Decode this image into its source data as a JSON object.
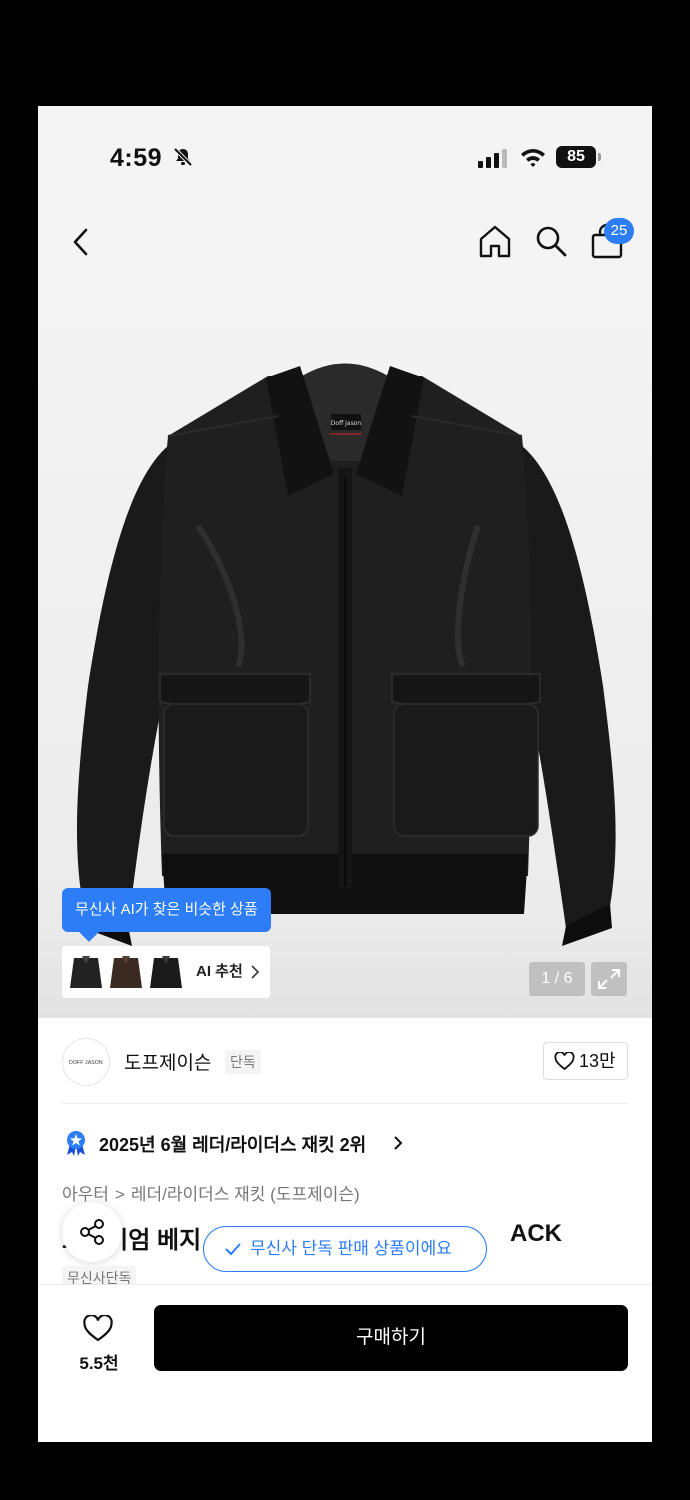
{
  "status_bar": {
    "time": "4:59",
    "battery": "85"
  },
  "nav": {
    "cart_count": "25"
  },
  "gallery": {
    "ai_tooltip": "무신사 AI가 찾은 비슷한 상품",
    "ai_label": "AI 추천",
    "pager": "1 / 6",
    "product_logo": "Doff Jason"
  },
  "brand": {
    "logo_text": "DOFF JASON",
    "name": "도프제이슨",
    "tag": "단독",
    "likes": "13만"
  },
  "ranking": {
    "text": "2025년 6월 레더/라이더스 재킷 2위"
  },
  "breadcrumb": {
    "level1": "아우터",
    "separator": ">",
    "level2": "레더/라이더스 재킷 (도프제이슨)"
  },
  "product": {
    "title_left": "프리미엄 베지",
    "title_right": "ACK",
    "exclusive_notice": "무신사 단독 판매 상품이에요",
    "tag": "무신사단독"
  },
  "bottom_bar": {
    "wish_count": "5.5천",
    "buy_label": "구매하기"
  },
  "colors": {
    "accent": "#2d7df6",
    "buy_button": "#000000"
  },
  "icons": [
    "bell-slash-icon",
    "signal-icon",
    "wifi-icon",
    "battery-icon",
    "back-icon",
    "home-icon",
    "search-icon",
    "shopping-bag-icon",
    "expand-icon",
    "heart-icon",
    "medal-icon",
    "share-icon",
    "check-icon",
    "chevron-right-icon"
  ]
}
